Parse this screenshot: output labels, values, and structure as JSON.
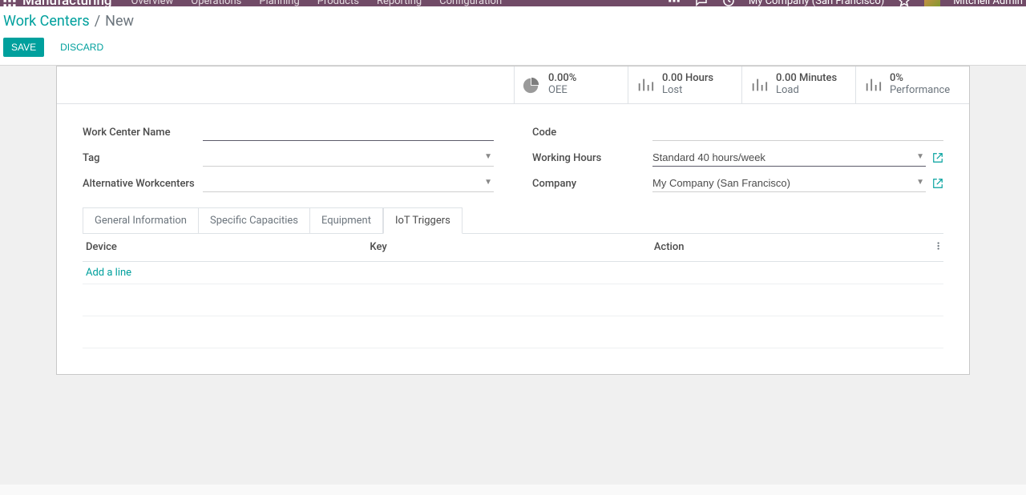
{
  "navbar": {
    "brand": "Manufacturing",
    "menu": [
      "Overview",
      "Operations",
      "Planning",
      "Products",
      "Reporting",
      "Configuration"
    ],
    "company": "My Company (San Francisco)",
    "user": "Mitchell Admin"
  },
  "breadcrumb": {
    "parent": "Work Centers",
    "current": "New"
  },
  "buttons": {
    "save": "Save",
    "discard": "Discard"
  },
  "stats": [
    {
      "icon": "pie",
      "value": "0.00%",
      "label": "OEE"
    },
    {
      "icon": "bars",
      "value": "0.00 Hours",
      "label": "Lost"
    },
    {
      "icon": "bars",
      "value": "0.00 Minutes",
      "label": "Load"
    },
    {
      "icon": "bars",
      "value": "0%",
      "label": "Performance"
    }
  ],
  "fields": {
    "left": {
      "name_label": "Work Center Name",
      "name_value": "",
      "tag_label": "Tag",
      "tag_value": "",
      "alt_label": "Alternative Workcenters",
      "alt_value": ""
    },
    "right": {
      "code_label": "Code",
      "code_value": "",
      "wh_label": "Working Hours",
      "wh_value": "Standard 40 hours/week",
      "company_label": "Company",
      "company_value": "My Company (San Francisco)"
    }
  },
  "tabs": [
    "General Information",
    "Specific Capacities",
    "Equipment",
    "IoT Triggers"
  ],
  "active_tab": 3,
  "iot_table": {
    "headers": [
      "Device",
      "Key",
      "Action"
    ],
    "rows": [],
    "add_line": "Add a line"
  }
}
